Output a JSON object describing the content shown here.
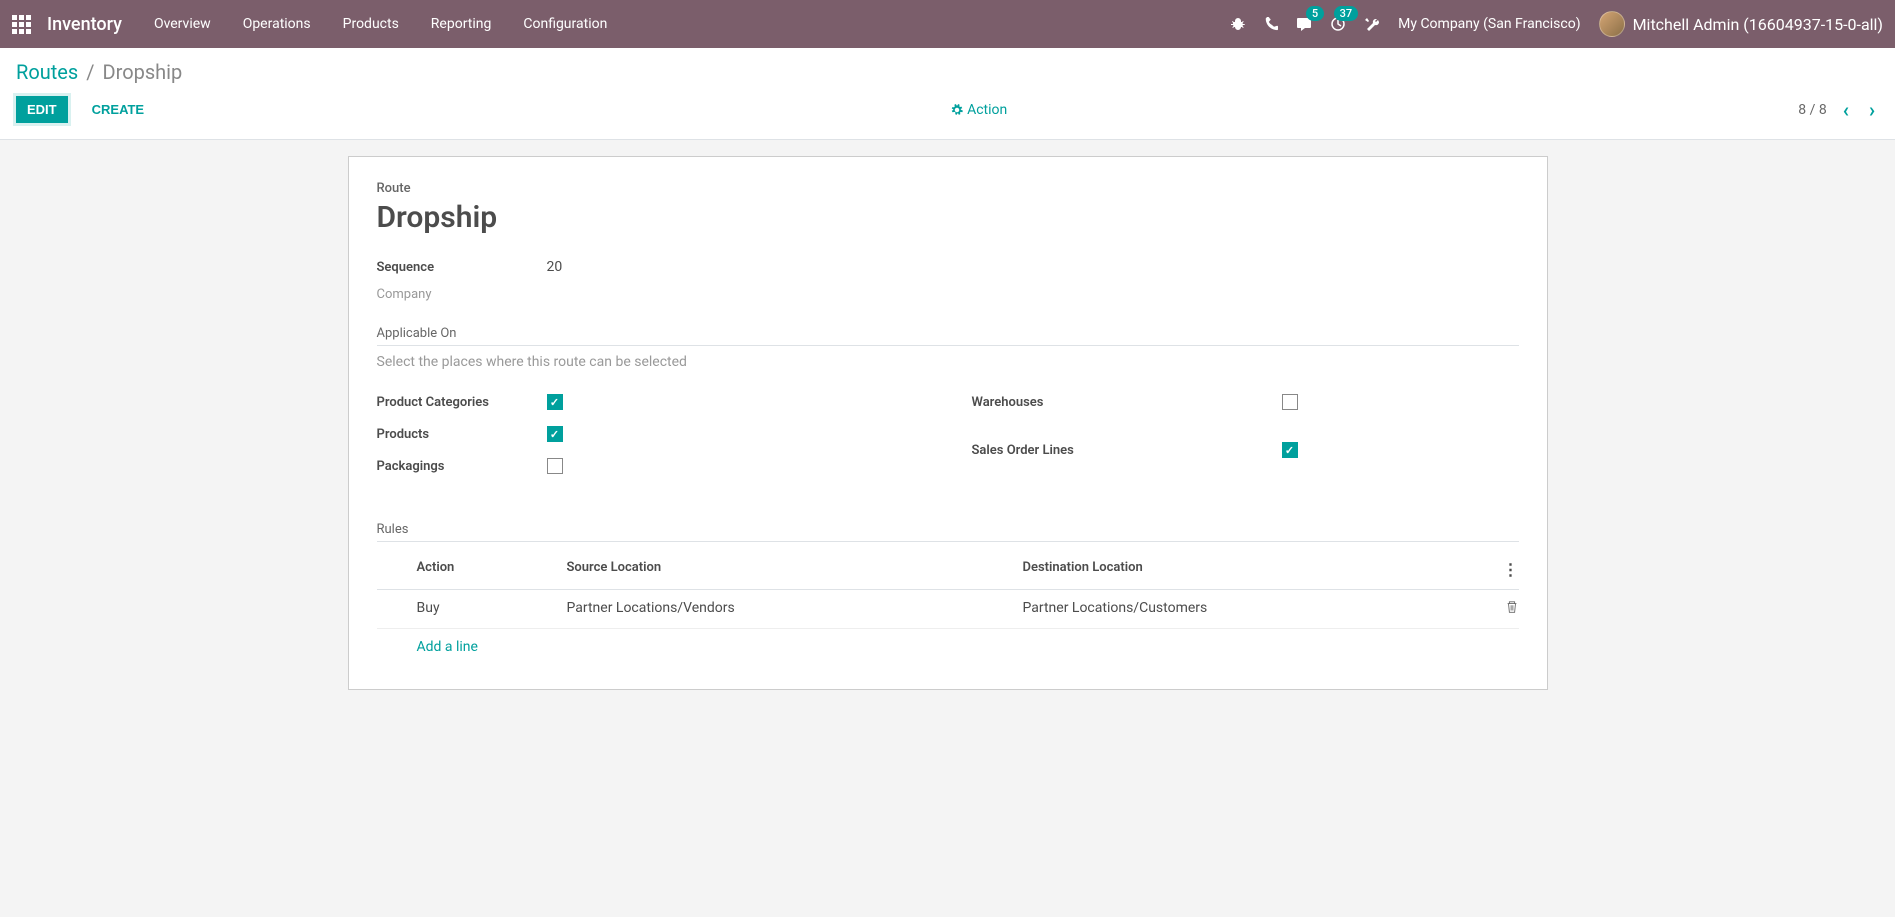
{
  "nav": {
    "app_title": "Inventory",
    "menu": [
      "Overview",
      "Operations",
      "Products",
      "Reporting",
      "Configuration"
    ],
    "messaging_count": "5",
    "activity_count": "37",
    "company": "My Company (San Francisco)",
    "user": "Mitchell Admin (16604937-15-0-all)"
  },
  "breadcrumb": {
    "parent": "Routes",
    "current": "Dropship"
  },
  "controls": {
    "edit": "EDIT",
    "create": "CREATE",
    "action": "Action",
    "pager": "8 / 8"
  },
  "form": {
    "label": "Route",
    "title": "Dropship",
    "sequence_label": "Sequence",
    "sequence_value": "20",
    "company_label": "Company",
    "applicable_title": "Applicable On",
    "applicable_hint": "Select the places where this route can be selected",
    "check_product_categories": "Product Categories",
    "check_products": "Products",
    "check_packagings": "Packagings",
    "check_warehouses": "Warehouses",
    "check_sales_order_lines": "Sales Order Lines",
    "rules_title": "Rules",
    "rules_headers": {
      "action": "Action",
      "source": "Source Location",
      "destination": "Destination Location"
    },
    "rules_rows": [
      {
        "action": "Buy",
        "source": "Partner Locations/Vendors",
        "destination": "Partner Locations/Customers"
      }
    ],
    "add_line": "Add a line"
  }
}
